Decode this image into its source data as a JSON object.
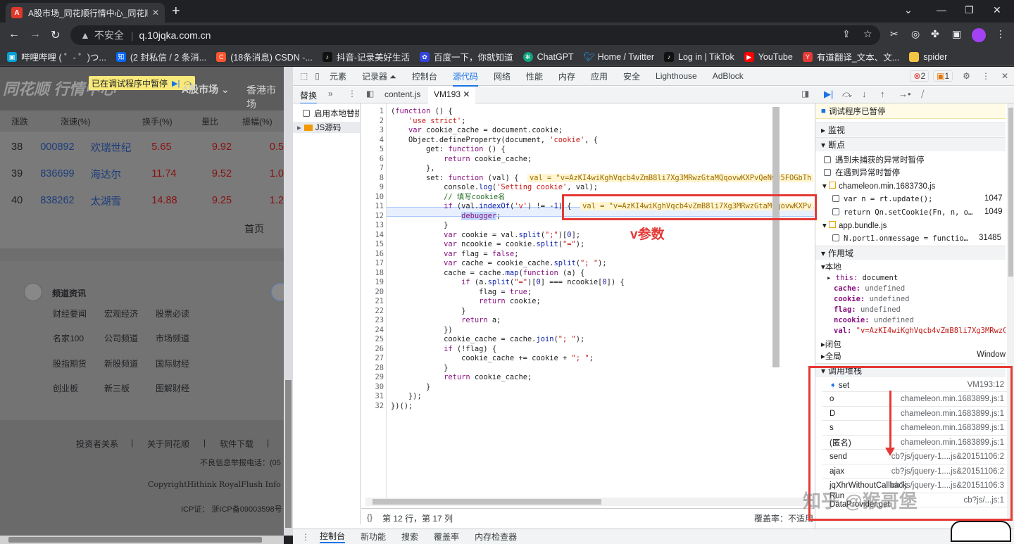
{
  "browser": {
    "tab_title": "A股市场_同花顺行情中心_同花顺",
    "tab_fav": "A",
    "url_warning": "不安全",
    "url": "q.10jqka.com.cn",
    "bookmarks": [
      {
        "label": "哔哩哔哩 ( ゜- ゜)つ...",
        "color": "#00a1d6"
      },
      {
        "label": "(2 封私信 / 2 条消...",
        "color": "#0066ff",
        "glyph": "知"
      },
      {
        "label": "(18条消息) CSDN -...",
        "color": "#fc5531",
        "glyph": "C"
      },
      {
        "label": "抖音-记录美好生活",
        "color": "#111111"
      },
      {
        "label": "百度一下，你就知道",
        "color": "#3245df"
      },
      {
        "label": "ChatGPT",
        "color": "#10a37f"
      },
      {
        "label": "Home / Twitter",
        "color": "#1d9bf0"
      },
      {
        "label": "Log in | TikTok",
        "color": "#111111"
      },
      {
        "label": "YouTube",
        "color": "#ff0000"
      },
      {
        "label": "有道翻译_文本、文...",
        "color": "#e53935",
        "glyph": "Y"
      },
      {
        "label": "spider",
        "color": "#f4c542"
      }
    ]
  },
  "page": {
    "logo": "同花顺 行情中心",
    "paused_label": "已在调试程序中暂停",
    "nav_a": "A股市场",
    "nav_hk": "香港市场",
    "headers": [
      "涨跌",
      "涨速(%)",
      "换手(%)",
      "量比",
      "振幅(%)"
    ],
    "rows": [
      {
        "n": "38",
        "code": "000892",
        "name": "欢瑞世纪",
        "v1": "5.65",
        "v2": "9.92",
        "v3": "0.5"
      },
      {
        "n": "39",
        "code": "836699",
        "name": "海达尔",
        "v1": "11.74",
        "v2": "9.52",
        "v3": "1.0"
      },
      {
        "n": "40",
        "code": "838262",
        "name": "太湖雪",
        "v1": "14.88",
        "v2": "9.25",
        "v3": "1.2"
      }
    ],
    "first_page": "首页",
    "channel_title": "频道资讯",
    "channel_links": [
      [
        "财经要闻",
        "宏观经济",
        "股票必读"
      ],
      [
        "名家100",
        "公司频道",
        "市场频道"
      ],
      [
        "股指期货",
        "新股频道",
        "国际财经"
      ],
      [
        "创业板",
        "新三板",
        "图解财经"
      ]
    ],
    "footer_links": [
      "投资者关系",
      "关于同花顺",
      "软件下载"
    ],
    "footer_sep": "|",
    "report": "不良信息举报电话：(05",
    "copyright": "CopyrightHithink RoyalFlush Info",
    "icp": "ICP证： 浙ICP备09003598号"
  },
  "devtools": {
    "tabs": [
      "元素",
      "记录器 ⏶",
      "控制台",
      "源代码",
      "网络",
      "性能",
      "内存",
      "应用",
      "安全",
      "Lighthouse",
      "AdBlock"
    ],
    "active_tab": "源代码",
    "errors": "2",
    "warnings": "1",
    "sub_left": "替换",
    "sub_more": "»",
    "file_tabs": [
      "content.js",
      "VM193"
    ],
    "enable_local": "启用本地替换",
    "js_source": "JS源码",
    "status": "第 12 行，第 17 列",
    "coverage": "覆盖率：不适用",
    "drawer_tabs": [
      "控制台",
      "新功能",
      "搜索",
      "覆盖率",
      "内存检查器"
    ],
    "code_lines": [
      "1",
      "2",
      "3",
      "4",
      "5",
      "6",
      "7",
      "8",
      "9",
      "10",
      "11",
      "12",
      "13",
      "14",
      "15",
      "16",
      "17",
      "18",
      "19",
      "20",
      "21",
      "22",
      "23",
      "24",
      "25",
      "26",
      "27",
      "28",
      "29",
      "30",
      "31",
      "32"
    ],
    "inline_val": "val = \"v=AzKI4wiKghVqcb4vZmB8li7Xg3MRwzGtaMQqovwKXPvQeNwt5FOGbTh",
    "inline_val2": "val = \"v=AzKI4wiKghVqcb4vZmB8li7Xg3MRwzGtaMQqovwKXPv",
    "annotation": "v参数",
    "right": {
      "paused": "调试程序已暂停",
      "watch": "监视",
      "breakpoints": "断点",
      "bp_uncaught": "遇到未捕获的异常时暂停",
      "bp_caught": "在遇到异常时暂停",
      "file1": "chameleon.min.1683730.js",
      "bp1_code": "var n = rt.update();",
      "bp1_line": "1047",
      "bp2_code": "return Qn.setCookie(Fn, n, o…",
      "bp2_line": "1049",
      "file2": "app.bundle.js",
      "bp3_code": "N.port1.onmessage = functio…",
      "bp3_line": "31485",
      "scope": "作用域",
      "local": "本地",
      "this_k": "this:",
      "this_v": "document",
      "vars": [
        {
          "k": "cache:",
          "v": "undefined"
        },
        {
          "k": "cookie:",
          "v": "undefined"
        },
        {
          "k": "flag:",
          "v": "undefined"
        },
        {
          "k": "ncookie:",
          "v": "undefined"
        }
      ],
      "val_k": "val:",
      "val_v": "\"v=AzKI4wiKghVqcb4vZmB8li7Xg3MRwzG",
      "closure": "闭包",
      "global": "全局",
      "global_v": "Window",
      "callstack": "调用堆栈",
      "stack": [
        {
          "name": "set",
          "loc": "VM193:12"
        },
        {
          "name": "o",
          "loc": "chameleon.min.1683899.js:1"
        },
        {
          "name": "D",
          "loc": "chameleon.min.1683899.js:1"
        },
        {
          "name": "s",
          "loc": "chameleon.min.1683899.js:1"
        },
        {
          "name": "(匿名)",
          "loc": "chameleon.min.1683899.js:1"
        },
        {
          "name": "send",
          "loc": "cb?js/jquery-1....js&20151106:2"
        },
        {
          "name": "ajax",
          "loc": "cb?js/jquery-1....js&20151106:2"
        },
        {
          "name": "jqXhrWithoutCallback",
          "loc": "cb?js/jquery-1....js&20151106:3"
        },
        {
          "name": "Run DataProvider.get",
          "loc": "cb?js/...js:1"
        }
      ]
    }
  },
  "watermark": "知乎 @猴哥堡"
}
